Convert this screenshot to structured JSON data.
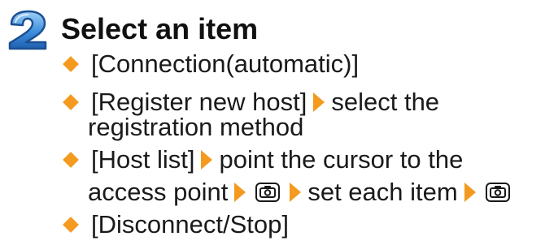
{
  "step": {
    "number": "2",
    "title": "Select an item",
    "items": [
      {
        "text": "[Connection(automatic)]"
      },
      {
        "text": "[Register new host]",
        "then": "select the",
        "continuation": "registration method"
      },
      {
        "text": "[Host list]",
        "then": "point the cursor to the",
        "continuation": "access point",
        "then2": "set each item"
      },
      {
        "text": "[Disconnect/Stop]"
      }
    ]
  },
  "icons": {
    "bullet": "orange-diamond-bullet-icon",
    "arrow": "orange-right-triangle-arrow-icon",
    "key": "camera-key-icon"
  },
  "colors": {
    "accent": "#f39a1f",
    "step_number": "#2e7fd0",
    "text": "#1a1a1a"
  }
}
